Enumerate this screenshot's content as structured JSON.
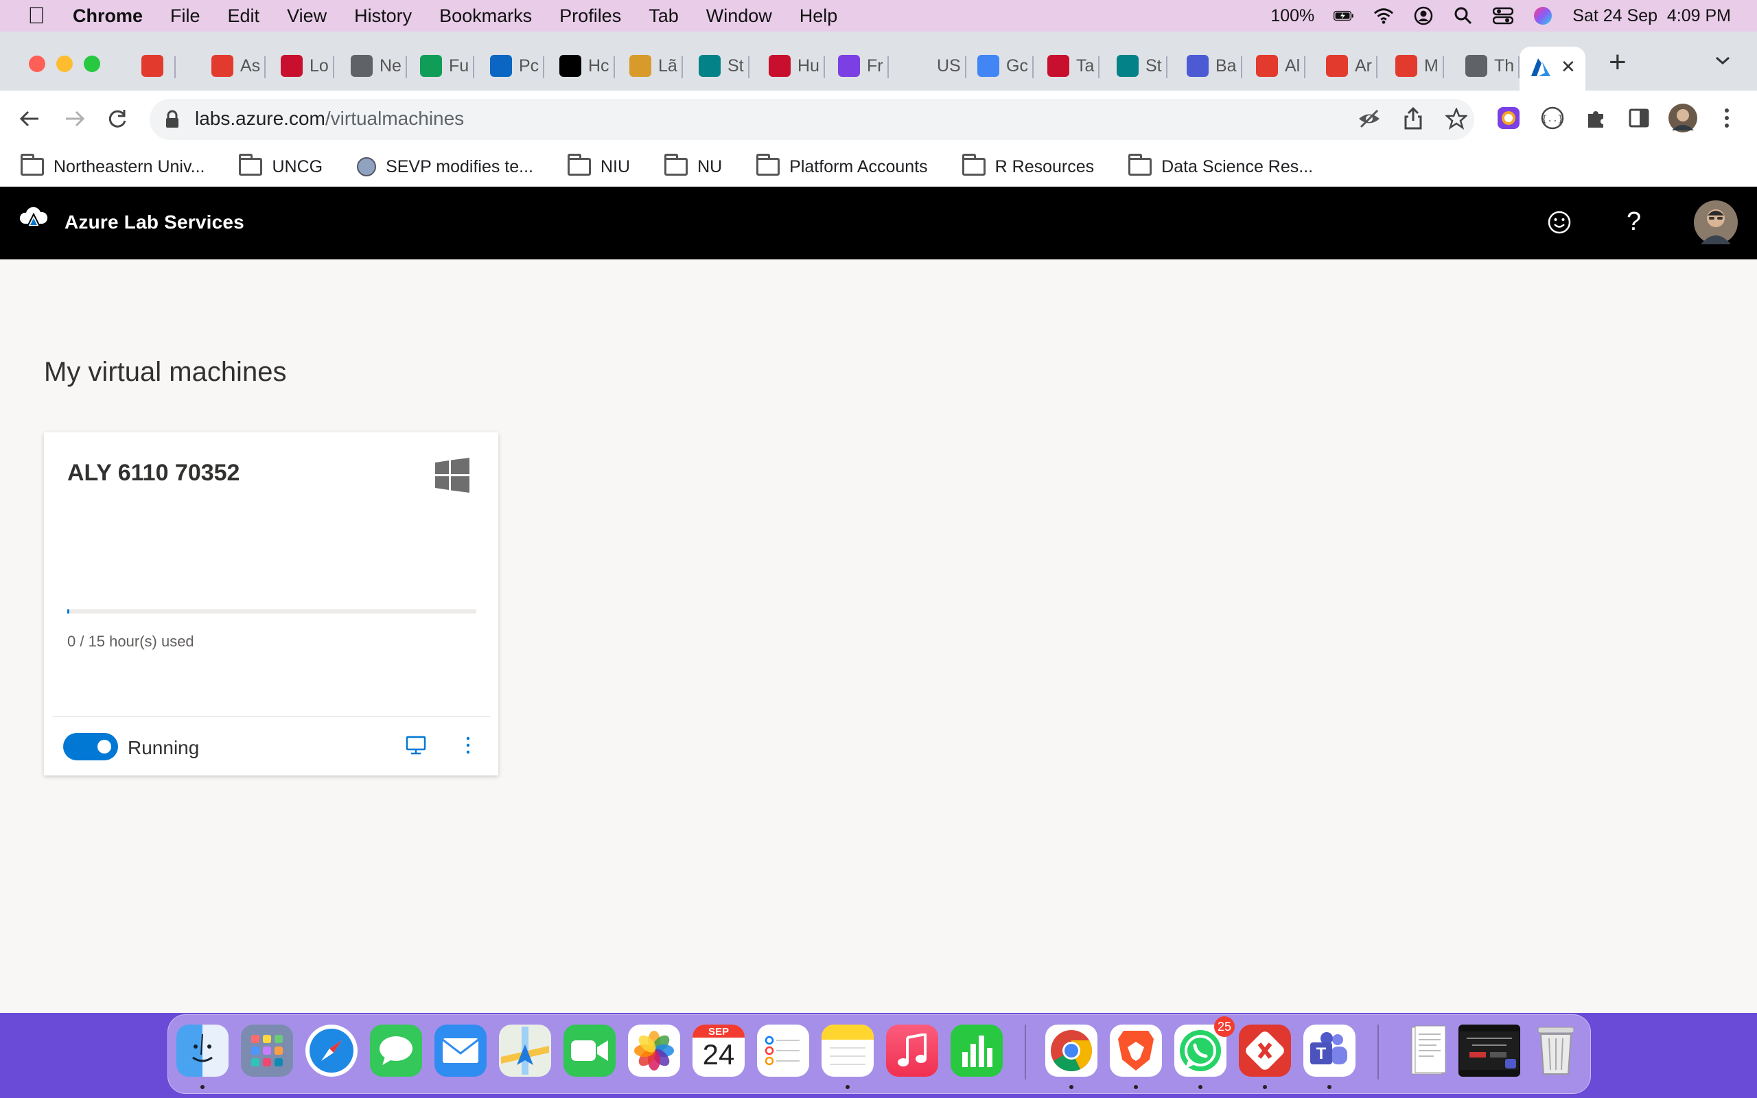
{
  "menubar": {
    "app_name": "Chrome",
    "menus": [
      "File",
      "Edit",
      "View",
      "History",
      "Bookmarks",
      "Profiles",
      "Tab",
      "Window",
      "Help"
    ],
    "battery": "100%",
    "datetime": "Sat 24 Sep  4:09 PM"
  },
  "tabs": [
    {
      "label": "",
      "icon": "canvas-icon",
      "color": "#e23b2e"
    },
    {
      "label": "As",
      "icon": "canvas-icon",
      "color": "#e23b2e"
    },
    {
      "label": "Lo",
      "icon": "northeastern-icon",
      "color": "#c8102e"
    },
    {
      "label": "Ne",
      "icon": "chrome-icon",
      "color": "#5f6368"
    },
    {
      "label": "Fu",
      "icon": "sheets-icon",
      "color": "#0f9d58"
    },
    {
      "label": "Pc",
      "icon": "linkedin-icon",
      "color": "#0a66c2"
    },
    {
      "label": "Hc",
      "icon": "medium-icon",
      "color": "#000000"
    },
    {
      "label": "Lã",
      "icon": "l-icon",
      "color": "#d89b2b"
    },
    {
      "label": "St",
      "icon": "sharepoint-icon",
      "color": "#038387"
    },
    {
      "label": "Hu",
      "icon": "northeastern-icon",
      "color": "#c8102e"
    },
    {
      "label": "Fr",
      "icon": "colorful-icon",
      "color": "#7b3fe4"
    },
    {
      "label": "US",
      "icon": "blank-icon",
      "color": "#dee1e6"
    },
    {
      "label": "Gc",
      "icon": "code-icon",
      "color": "#4285f4"
    },
    {
      "label": "Ta",
      "icon": "northeastern-icon",
      "color": "#c8102e"
    },
    {
      "label": "St",
      "icon": "sharepoint-icon",
      "color": "#038387"
    },
    {
      "label": "Ba",
      "icon": "power-icon",
      "color": "#4c5bd4"
    },
    {
      "label": "Al",
      "icon": "canvas-icon",
      "color": "#e23b2e"
    },
    {
      "label": "Ar",
      "icon": "canvas-icon",
      "color": "#e23b2e"
    },
    {
      "label": "M",
      "icon": "canvas-icon",
      "color": "#e23b2e"
    },
    {
      "label": "Th",
      "icon": "globe-icon",
      "color": "#5f6368"
    }
  ],
  "active_tab": {
    "icon": "azure-icon",
    "close": "✕"
  },
  "new_tab": "+",
  "url": {
    "host": "labs.azure.com",
    "path": "/virtualmachines"
  },
  "bookmarks": [
    {
      "label": "Northeastern Univ...",
      "type": "folder"
    },
    {
      "label": "UNCG",
      "type": "folder"
    },
    {
      "label": "SEVP modifies te...",
      "type": "site"
    },
    {
      "label": "NIU",
      "type": "folder"
    },
    {
      "label": "NU",
      "type": "folder"
    },
    {
      "label": "Platform Accounts",
      "type": "folder"
    },
    {
      "label": "R Resources",
      "type": "folder"
    },
    {
      "label": "Data Science Res...",
      "type": "folder"
    }
  ],
  "app": {
    "title": "Azure Lab Services",
    "page_title": "My virtual machines"
  },
  "vm": {
    "name": "ALY 6110 70352",
    "os_icon": "windows-icon",
    "usage_text": "0 / 15 hour(s) used",
    "used_hours": 0,
    "quota_hours": 15,
    "status": "Running",
    "running": true
  },
  "dock": {
    "apps": [
      "Finder",
      "Launchpad",
      "Safari",
      "Messages",
      "Mail",
      "Maps",
      "FaceTime",
      "Photos",
      "Calendar",
      "Reminders",
      "Notes",
      "Music",
      "Numbers",
      "Chrome",
      "Brave",
      "WhatsApp",
      "Remote Desktop",
      "Teams"
    ],
    "calendar_month": "SEP",
    "calendar_day": "24",
    "whatsapp_badge": "25"
  },
  "colors": {
    "accent": "#0078d4",
    "appbar": "#000000",
    "page_bg": "#f8f7f6",
    "dock_bg": "#6a4bd8"
  }
}
